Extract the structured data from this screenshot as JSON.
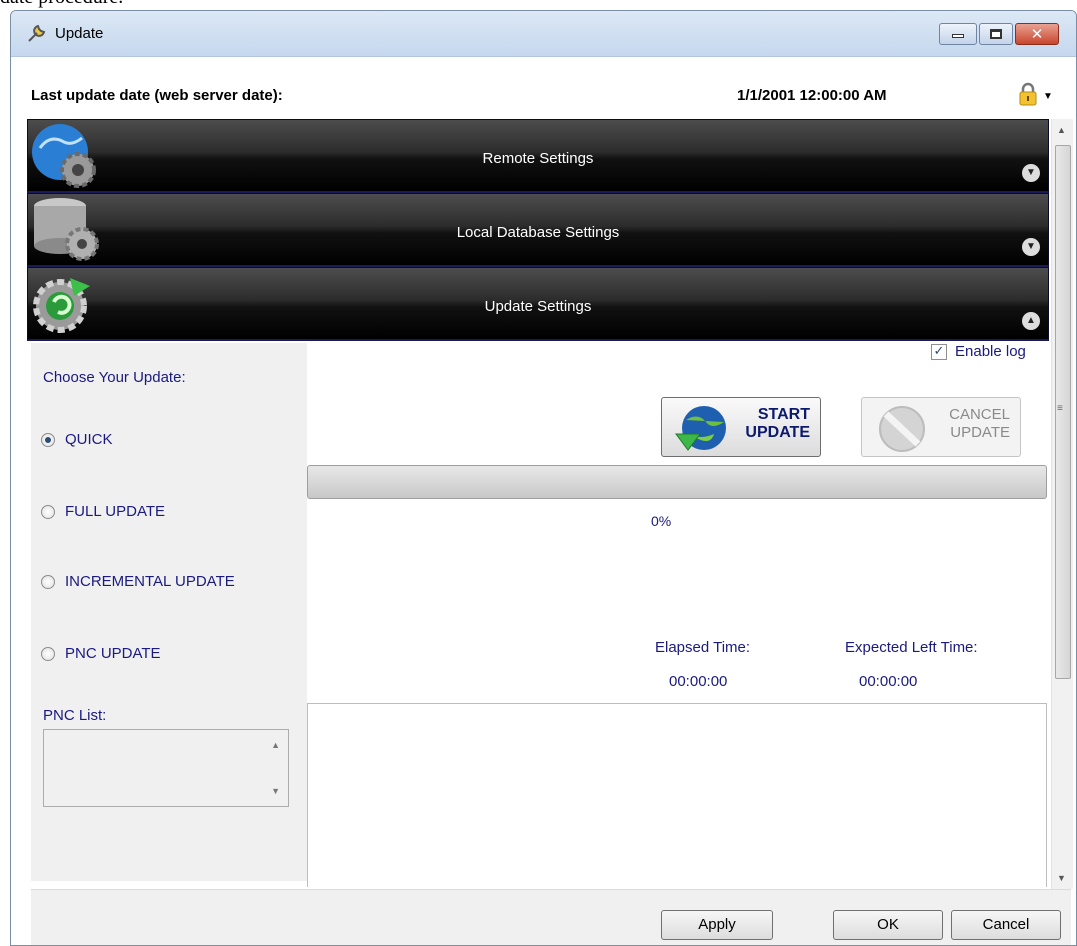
{
  "page_fragment": "date procedure.",
  "window": {
    "title": "Update"
  },
  "titlebar_buttons": {
    "minimize": "minimize",
    "maximize": "maximize",
    "close": "✕"
  },
  "header": {
    "last_update_label": "Last update date (web server date):",
    "last_update_value": "1/1/2001 12:00:00 AM",
    "lock_icon": "lock-icon"
  },
  "sections": [
    {
      "label": "Remote Settings",
      "icon": "globe-gear-icon",
      "state": "collapsed"
    },
    {
      "label": "Local Database Settings",
      "icon": "database-gear-icon",
      "state": "collapsed"
    },
    {
      "label": "Update Settings",
      "icon": "refresh-gear-icon",
      "state": "expanded"
    }
  ],
  "update": {
    "choose_label": "Choose Your Update:",
    "options": [
      {
        "label": "QUICK",
        "checked": true
      },
      {
        "label": "FULL UPDATE",
        "checked": false
      },
      {
        "label": "INCREMENTAL UPDATE",
        "checked": false
      },
      {
        "label": "PNC UPDATE",
        "checked": false
      }
    ],
    "pnc_list_label": "PNC List:",
    "enable_log_label": "Enable log",
    "enable_log_checked": true,
    "start_button": {
      "line1": "START",
      "line2": "UPDATE"
    },
    "cancel_button": {
      "line1": "CANCEL",
      "line2": "UPDATE",
      "enabled": false
    },
    "progress_percent": 0,
    "progress_text": "0%",
    "elapsed_label": "Elapsed Time:",
    "elapsed_value": "00:00:00",
    "expected_label": "Expected Left Time:",
    "expected_value": "00:00:00"
  },
  "footer": {
    "apply": "Apply",
    "ok": "OK",
    "cancel": "Cancel"
  },
  "colors": {
    "accent_text": "#1a1a80",
    "band_dark": "#000000",
    "start_text": "#0c1a6e"
  }
}
